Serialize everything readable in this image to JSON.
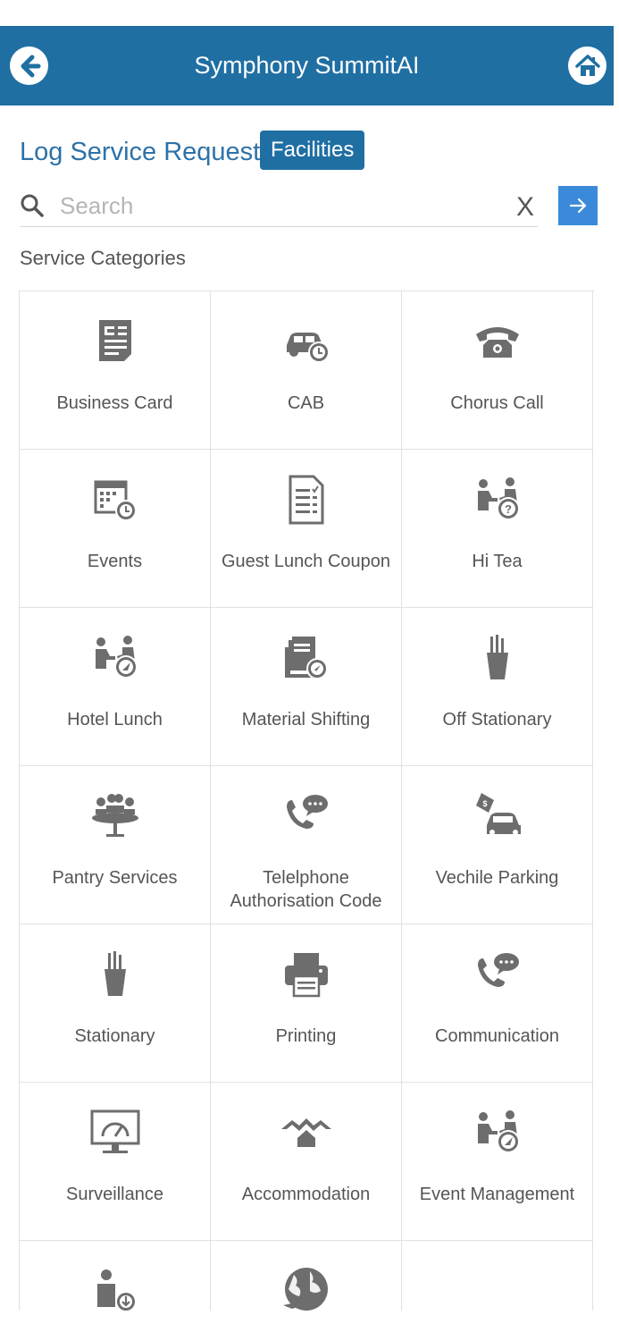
{
  "header": {
    "title": "Symphony SummitAI",
    "back_icon": "back-arrow-icon",
    "home_icon": "home-icon",
    "color": "#1f6fa3"
  },
  "page": {
    "title": "Log Service Request",
    "badge": "Facilities"
  },
  "search": {
    "placeholder": "Search",
    "value": "",
    "clear_label": "X",
    "go_icon": "arrow-right-icon"
  },
  "section_label": "Service Categories",
  "categories": [
    {
      "label": "Business Card",
      "icon": "document-icon"
    },
    {
      "label": "CAB",
      "icon": "car-clock-icon"
    },
    {
      "label": "Chorus Call",
      "icon": "telephone-icon"
    },
    {
      "label": "Events",
      "icon": "calendar-clock-icon"
    },
    {
      "label": "Guest Lunch Coupon",
      "icon": "checklist-document-icon"
    },
    {
      "label": "Hi Tea",
      "icon": "people-question-icon"
    },
    {
      "label": "Hotel Lunch",
      "icon": "people-compass-icon"
    },
    {
      "label": "Material Shifting",
      "icon": "folders-compass-icon"
    },
    {
      "label": "Off Stationary",
      "icon": "pencil-cup-icon"
    },
    {
      "label": "Pantry Services",
      "icon": "meeting-table-icon"
    },
    {
      "label": "Telelphone Authorisation Code",
      "icon": "phone-chat-icon"
    },
    {
      "label": "Vechile Parking",
      "icon": "car-parking-icon"
    },
    {
      "label": "Stationary",
      "icon": "pencil-cup-icon"
    },
    {
      "label": "Printing",
      "icon": "printer-icon"
    },
    {
      "label": "Communication",
      "icon": "phone-chat-icon"
    },
    {
      "label": "Surveillance",
      "icon": "monitor-gauge-icon"
    },
    {
      "label": "Accommodation",
      "icon": "houses-icon"
    },
    {
      "label": "Event Management",
      "icon": "people-compass-icon"
    },
    {
      "label": "",
      "icon": "person-download-icon"
    },
    {
      "label": "",
      "icon": "globe-plane-icon"
    }
  ]
}
